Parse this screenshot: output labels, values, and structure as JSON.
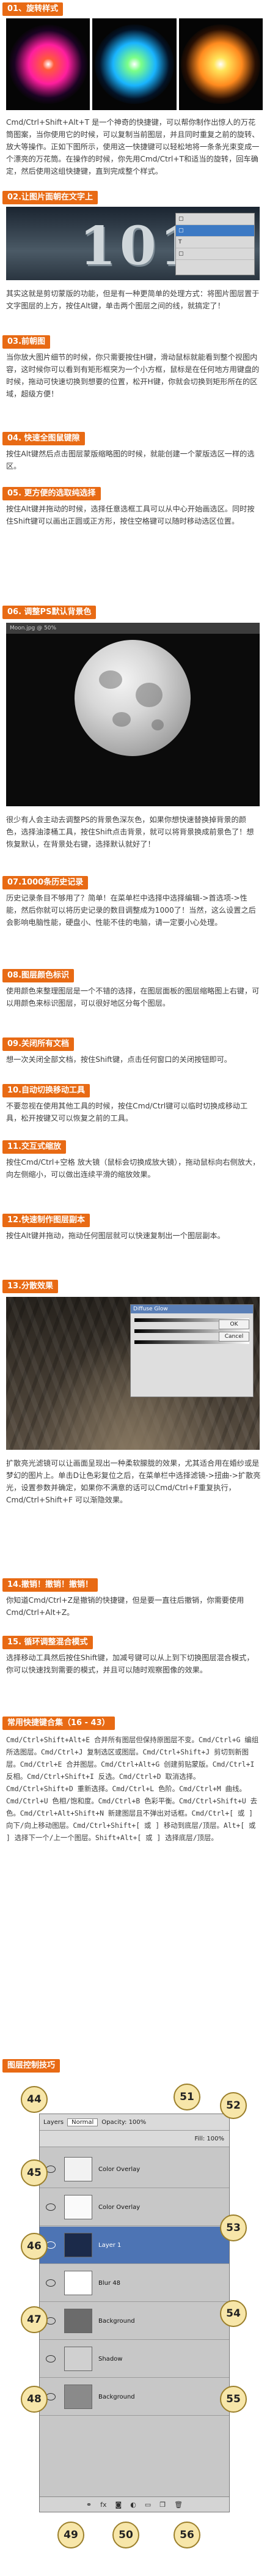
{
  "sections": [
    {
      "heading": "01、旋转样式"
    },
    {
      "heading": "02.让图片面朝在文字上"
    },
    {
      "heading": "03.前朝图"
    },
    {
      "heading": "04. 快速全图鼠键隙"
    },
    {
      "heading": "05. 更方便的选取纯选择"
    },
    {
      "heading": "06. 调整PS默认背景色"
    },
    {
      "heading": "07.1000条历史记录"
    },
    {
      "heading": "08.图层颜色标识"
    },
    {
      "heading": "09.关闭所有文档"
    },
    {
      "heading": "10.自动切换移动工具"
    },
    {
      "heading": "11.交互式缩放"
    },
    {
      "heading": "12.快速制作图层副本"
    },
    {
      "heading": "13.分散效果"
    },
    {
      "heading": "14.撤销！撤销！撤销！"
    },
    {
      "heading": "15. 循环调整混合模式"
    },
    {
      "heading": "常用快捷键合集（16 - 43）"
    },
    {
      "heading": "图层控制技巧"
    }
  ],
  "paragraphs": {
    "p01": "Cmd/Ctrl+Shift+Alt+T 是一个神奇的快捷键，可以帮你制作出惊人的万花筒图案，当你使用它的时候，可以复制当前图层，并且同时重复之前的旋转、放大等操作。正如下图所示，使用这一快捷键可以轻松地将一条条光束变成一个漂亮的万花筒。在操作的时候，你先用Cmd/Ctrl+T和适当的旋转，回车确定，然后使用这组快捷键，直到完成整个样式。",
    "p02": "其实这就是剪切蒙版的功能，但是有一种更简单的处理方式：将图片图层置于文字图层的上方，按住Alt键，单击两个图层之间的线，就搞定了！",
    "p03": "当你放大图片细节的时候，你只需要按住H键，滑动鼠标就能看到整个视图内容，这时候你可以看到有矩形框突为一个小方框，鼠标是在任何地方用键盘的时候，拖动可快速切换到想要的位置，松开H键，你就会切换到矩形所在的区域，超级方便！",
    "p04": "按住Alt键然后点击图层蒙版缩略图的时候，就能创建一个蒙版选区一样的选区。",
    "p05": "按住Alt键并拖动的时候，选择任意选框工具可以从中心开始画选区。同时按住Shift键可以画出正圆或正方形，按住空格键可以随时移动选区位置。",
    "p06": "很少有人会主动去调整PS的背景色深灰色，如果你想快速替换掉背景的颜色，选择油漆桶工具，按住Shift点击背景，就可以将背景换成前景色了！想恢复默认，在背景处右键，选择默认就好了！",
    "p07": "历史记录条目不够用了？简单！在菜单栏中选择中选择编辑->首选项->性能，然后你就可以将历史记录的数目调整成为1000了！当然，这么设置之后会影响电脑性能，硬盘小、性能不佳的电脑，请一定要小心处理。",
    "p08": "使用颜色来整理图层是一个不错的选择，在图层面板的图层缩略图上右键，可以用颜色来标识图层，可以很好地区分每个图层。",
    "p09": "想一次关闭全部文档，按住Shift键，点击任何窗口的关闭按钮即可。",
    "p10": "不要忽视在使用其他工具的时候，按住Cmd/Ctrl键可以临时切换成移动工具，松开按键又可以恢复之前的工具。",
    "p11": "按住Cmd/Ctrl+空格 放大镜（鼠标会切换成放大镜），拖动鼠标向右侧放大，向左侧缩小，可以做出连续平滑的缩放效果。",
    "p12": "按住Alt键并拖动，拖动任何图层就可以快速复制出一个图层副本。",
    "p13": "扩散亮光滤镜可以让画面呈现出一种柔软朦胧的效果，尤其适合用在婚纱或是梦幻的图片上。单击D让色彩复位之后，在菜单栏中选择滤镜->扭曲->扩散亮光，设置参数并确定，如果你不满意的话可以Cmd/Ctrl+F重复执行，Cmd/Ctrl+Shift+F 可以渐隐效果。",
    "p14": "你知道Cmd/Ctrl+Z是撤销的快捷键，但是要一直往后撤销，你需要使用Cmd/Ctrl+Alt+Z。",
    "p15": "选择移动工具然后按住Shift键，加减号键可以从上到下切换图层混合模式，你可以快速找到需要的模式，并且可以随时观察图像的效果。",
    "p16": "Cmd/Ctrl+Shift+Alt+E 合并所有图层但保持原图层不变。Cmd/Ctrl+G 编组所选图层。Cmd/Ctrl+J 复制选区或图层。Cmd/Ctrl+Shift+J 剪切到新图层。Cmd/Ctrl+E 合并图层。Cmd/Ctrl+Alt+G 创建剪贴蒙版。Cmd/Ctrl+I 反相。Cmd/Ctrl+Shift+I 反选。Cmd/Ctrl+D 取消选择。Cmd/Ctrl+Shift+D 重新选择。Cmd/Ctrl+L 色阶。Cmd/Ctrl+M 曲线。Cmd/Ctrl+U 色相/饱和度。Cmd/Ctrl+B 色彩平衡。Cmd/Ctrl+Shift+U 去色。Cmd/Ctrl+Alt+Shift+N 新建图层且不弹出对话框。Cmd/Ctrl+[ 或 ] 向下/向上移动图层。Cmd/Ctrl+Shift+[ 或 ] 移动到底层/顶层。Alt+[ 或 ] 选择下一个/上一个图层。Shift+Alt+[ 或 ] 选择底层/顶层。"
  },
  "images": {
    "layers_panel": {
      "title": "Layers",
      "blend_mode": "Normal",
      "opacity_label": "Opacity: 100%",
      "fill_label": "Fill: 100%",
      "rows": [
        {
          "name": "Color Overlay"
        },
        {
          "name": "Color Overlay"
        },
        {
          "name": "Layer 1"
        },
        {
          "name": "Blur 48"
        },
        {
          "name": "Background"
        },
        {
          "name": "Shadow"
        },
        {
          "name": "Background"
        }
      ],
      "callouts": [
        "44",
        "45",
        "46",
        "47",
        "48",
        "49",
        "50",
        "51",
        "52",
        "53",
        "54",
        "55",
        "56"
      ]
    },
    "dialog": {
      "title": "Diffuse Glow",
      "ok": "OK",
      "cancel": "Cancel"
    },
    "moon_toolbar": "Moon.jpg @ 50%"
  },
  "colors": {
    "heading_orange": "#e86a14",
    "selection_blue": "#4d74b4"
  }
}
